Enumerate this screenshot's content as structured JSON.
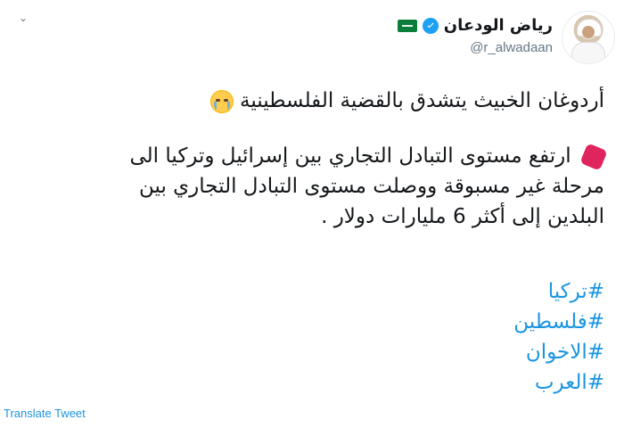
{
  "tweet": {
    "display_name": "رياض الودعان",
    "handle": "@r_alwadaan",
    "lines": [
      "أردوغان الخبيث يتشدق بالقضية الفلسطينية",
      "ارتفع مستوى التبادل التجاري بين إسرائيل وتركيا الى",
      "مرحلة غير مسبوقة ووصلت مستوى التبادل التجاري بين",
      "البلدين إلى أكثر 6 مليارات دولار ."
    ],
    "hashtags": [
      "#تركيا",
      "#فلسطين",
      "#الاخوان",
      "#العرب"
    ],
    "translate_label": "Translate Tweet"
  },
  "icons": {
    "caret": "chevron-down-icon",
    "verified": "verified-badge-icon",
    "flag": "saudi-flag-icon",
    "emoji_1": "loudly-crying-face-emoji",
    "emoji_2": "stop-sign-emoji"
  },
  "colors": {
    "link": "#1b95e0",
    "verified": "#1da1f2",
    "text": "#14171a",
    "muted": "#657786"
  }
}
